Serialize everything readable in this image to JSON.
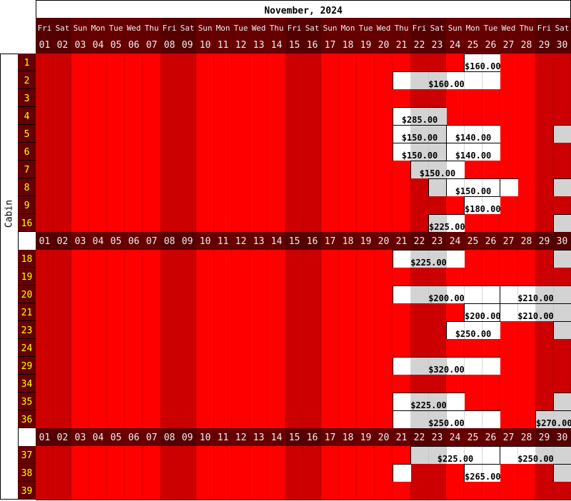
{
  "title": "November, 2024",
  "side_label": "Cabin",
  "colors": {
    "weekday": "#ff0000",
    "weekend": "#cc0000",
    "available": "#ffffff",
    "available_weekend": "#d3d3d3",
    "header": "#660000",
    "cabin_text": "#ffff00"
  },
  "days": [
    {
      "name": "Fri",
      "date": "01"
    },
    {
      "name": "Sat",
      "date": "02"
    },
    {
      "name": "Sun",
      "date": "03"
    },
    {
      "name": "Mon",
      "date": "04"
    },
    {
      "name": "Tue",
      "date": "05"
    },
    {
      "name": "Wed",
      "date": "06"
    },
    {
      "name": "Thu",
      "date": "07"
    },
    {
      "name": "Fri",
      "date": "08"
    },
    {
      "name": "Sat",
      "date": "09"
    },
    {
      "name": "Sun",
      "date": "10"
    },
    {
      "name": "Mon",
      "date": "11"
    },
    {
      "name": "Tue",
      "date": "12"
    },
    {
      "name": "Wed",
      "date": "13"
    },
    {
      "name": "Thu",
      "date": "14"
    },
    {
      "name": "Fri",
      "date": "15"
    },
    {
      "name": "Sat",
      "date": "16"
    },
    {
      "name": "Sun",
      "date": "17"
    },
    {
      "name": "Mon",
      "date": "18"
    },
    {
      "name": "Tue",
      "date": "19"
    },
    {
      "name": "Wed",
      "date": "20"
    },
    {
      "name": "Thu",
      "date": "21"
    },
    {
      "name": "Fri",
      "date": "22"
    },
    {
      "name": "Sat",
      "date": "23"
    },
    {
      "name": "Sun",
      "date": "24"
    },
    {
      "name": "Mon",
      "date": "25"
    },
    {
      "name": "Tue",
      "date": "26"
    },
    {
      "name": "Wed",
      "date": "27"
    },
    {
      "name": "Thu",
      "date": "28"
    },
    {
      "name": "Fri",
      "date": "29"
    },
    {
      "name": "Sat",
      "date": "30"
    }
  ],
  "groups": [
    {
      "cabins": [
        {
          "id": "1",
          "available": [
            {
              "from": 25,
              "to": 26,
              "price": "$160.00"
            }
          ]
        },
        {
          "id": "2",
          "available": [
            {
              "from": 21,
              "to": 26,
              "price": "$160.00"
            }
          ]
        },
        {
          "id": "3",
          "available": []
        },
        {
          "id": "4",
          "available": [
            {
              "from": 21,
              "to": 23,
              "price": "$285.00"
            }
          ]
        },
        {
          "id": "5",
          "available": [
            {
              "from": 21,
              "to": 23,
              "price": "$150.00"
            },
            {
              "from": 24,
              "to": 26,
              "price": "$140.00"
            },
            {
              "from": 30,
              "to": 30,
              "price": ""
            }
          ]
        },
        {
          "id": "6",
          "available": [
            {
              "from": 21,
              "to": 23,
              "price": "$150.00"
            },
            {
              "from": 24,
              "to": 26,
              "price": "$140.00"
            }
          ]
        },
        {
          "id": "7",
          "available": [
            {
              "from": 22,
              "to": 24,
              "price": "$150.00"
            }
          ]
        },
        {
          "id": "8",
          "available": [
            {
              "from": 23,
              "to": 23,
              "price": ""
            },
            {
              "from": 24,
              "to": 26,
              "price": "$150.00"
            },
            {
              "from": 27,
              "to": 27,
              "price": ""
            },
            {
              "from": 30,
              "to": 30,
              "price": ""
            }
          ]
        },
        {
          "id": "9",
          "available": [
            {
              "from": 25,
              "to": 26,
              "price": "$180.00"
            }
          ]
        },
        {
          "id": "16",
          "available": [
            {
              "from": 23,
              "to": 24,
              "price": "$225.00"
            },
            {
              "from": 30,
              "to": 30,
              "price": ""
            }
          ]
        }
      ]
    },
    {
      "cabins": [
        {
          "id": "18",
          "available": [
            {
              "from": 21,
              "to": 24,
              "price": "$225.00"
            },
            {
              "from": 30,
              "to": 30,
              "price": ""
            }
          ]
        },
        {
          "id": "19",
          "available": []
        },
        {
          "id": "20",
          "available": [
            {
              "from": 21,
              "to": 26,
              "price": "$200.00"
            },
            {
              "from": 27,
              "to": 30,
              "price": "$210.00"
            }
          ]
        },
        {
          "id": "21",
          "available": [
            {
              "from": 25,
              "to": 26,
              "price": "$200.00"
            },
            {
              "from": 27,
              "to": 30,
              "price": "$210.00"
            }
          ]
        },
        {
          "id": "23",
          "available": [
            {
              "from": 24,
              "to": 26,
              "price": "$250.00"
            },
            {
              "from": 30,
              "to": 30,
              "price": ""
            }
          ]
        },
        {
          "id": "24",
          "available": []
        },
        {
          "id": "29",
          "available": [
            {
              "from": 21,
              "to": 26,
              "price": "$320.00"
            }
          ]
        },
        {
          "id": "34",
          "available": []
        },
        {
          "id": "35",
          "available": [
            {
              "from": 21,
              "to": 24,
              "price": "$225.00"
            },
            {
              "from": 30,
              "to": 30,
              "price": ""
            }
          ]
        },
        {
          "id": "36",
          "available": [
            {
              "from": 21,
              "to": 26,
              "price": "$250.00"
            },
            {
              "from": 29,
              "to": 30,
              "price": "$270.00"
            }
          ]
        }
      ]
    },
    {
      "cabins": [
        {
          "id": "37",
          "available": [
            {
              "from": 22,
              "to": 26,
              "price": "$225.00"
            },
            {
              "from": 27,
              "to": 30,
              "price": "$250.00"
            }
          ]
        },
        {
          "id": "38",
          "available": [
            {
              "from": 21,
              "to": 21,
              "price": ""
            },
            {
              "from": 25,
              "to": 26,
              "price": "$265.00"
            },
            {
              "from": 30,
              "to": 30,
              "price": ""
            }
          ]
        },
        {
          "id": "39",
          "available": []
        }
      ]
    }
  ]
}
